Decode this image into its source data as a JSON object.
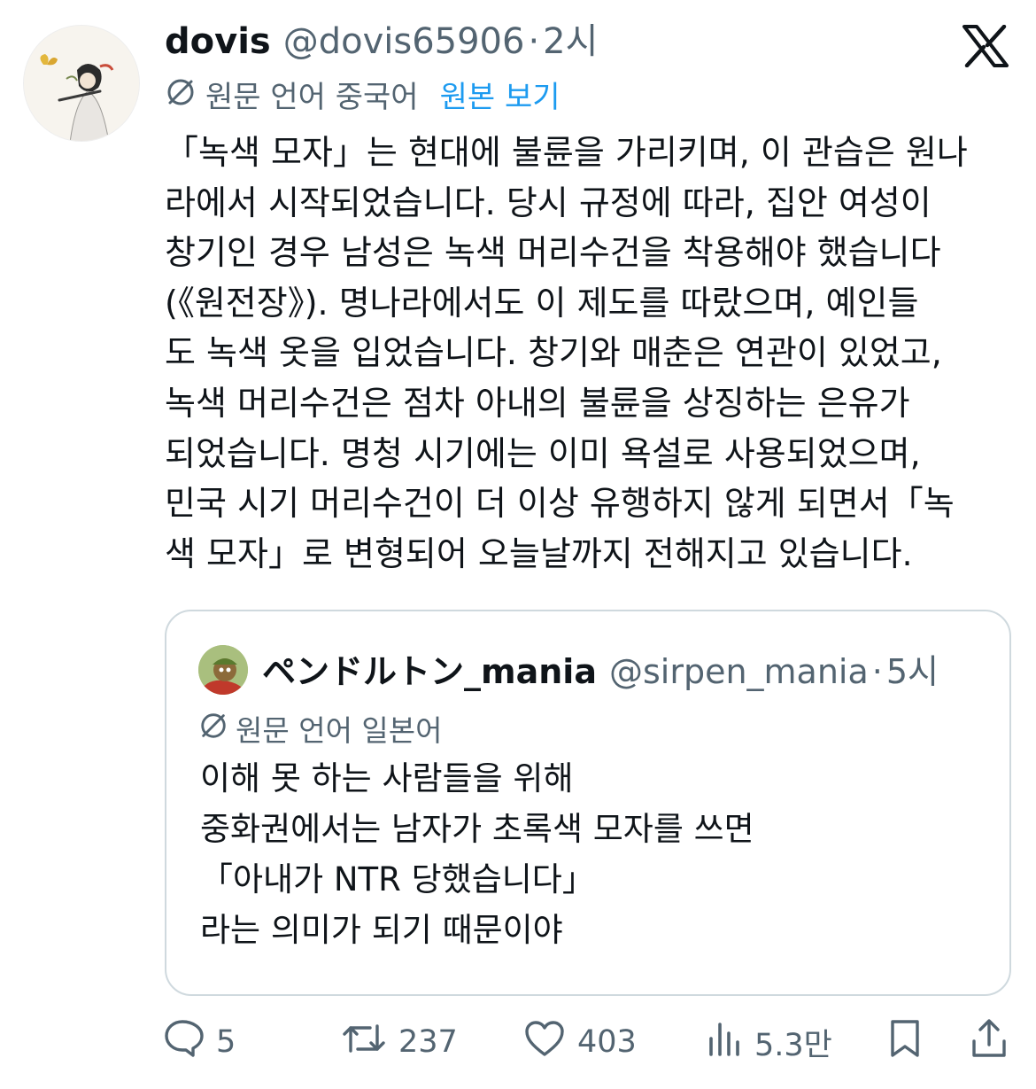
{
  "tweet": {
    "author_name": "dovis",
    "author_handle": "@dovis65906",
    "separator": "·",
    "time": "2시",
    "translation_label": "원문 언어 중국어",
    "show_original": "원본 보기",
    "text_lines": [
      "「녹색 모자」는 현대에 불륜을 가리키며, 이 관습은 원나",
      "라에서 시작되었습니다. 당시 규정에 따라, 집안 여성이",
      "창기인 경우 남성은 녹색 머리수건을 착용해야 했습니다",
      "(《원전장》). 명나라에서도 이 제도를 따랐으며, 예인들",
      "도 녹색 옷을 입었습니다. 창기와 매춘은 연관이 있었고,",
      "녹색 머리수건은 점차 아내의 불륜을 상징하는 은유가",
      "되었습니다. 명청 시기에는 이미 욕설로 사용되었으며,",
      "민국 시기 머리수건이 더 이상 유행하지 않게 되면서「녹",
      "색 모자」로 변형되어 오늘날까지 전해지고 있습니다."
    ]
  },
  "quote": {
    "author_name": "ペンドルトン_mania",
    "author_handle": "@sirpen_mania",
    "separator": "·",
    "time": "5시",
    "translation_label": "원문 언어 일본어",
    "text_lines": [
      "이해 못 하는 사람들을 위해",
      "중화권에서는 남자가 초록색 모자를 쓰면",
      "「아내가 NTR 당했습니다」",
      "라는 의미가 되기 때문이야"
    ]
  },
  "actions": {
    "replies": "5",
    "reposts": "237",
    "likes": "403",
    "views": "5.3만"
  },
  "icons": {
    "close": "x-logo-icon",
    "translate": "translate-globe-icon",
    "reply": "reply-icon",
    "repost": "repost-icon",
    "like": "heart-icon",
    "views": "views-icon",
    "bookmark": "bookmark-icon",
    "share": "share-icon"
  },
  "colors": {
    "text": "#0f1419",
    "secondary": "#536471",
    "link": "#1d9bf0",
    "border": "#cfd9de"
  }
}
